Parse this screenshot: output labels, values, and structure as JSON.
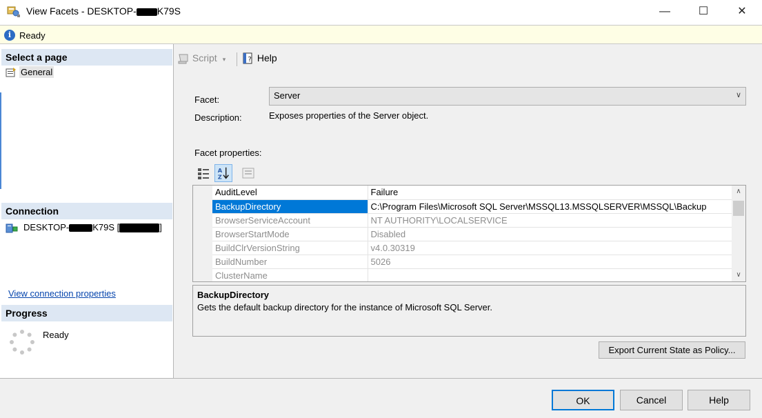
{
  "window": {
    "title_prefix": "View Facets - DESKTOP-",
    "title_suffix": "K79S",
    "minimize": "—",
    "maximize": "☐",
    "close": "✕"
  },
  "status": {
    "text": "Ready",
    "icon": "info-icon"
  },
  "left": {
    "select_page_header": "Select a page",
    "pages": [
      {
        "label": "General",
        "icon": "general-page-icon"
      }
    ],
    "connection_header": "Connection",
    "connection_prefix": "DESKTOP-",
    "connection_suffix": "K79S [",
    "connection_end": "]",
    "view_connection_link": "View connection properties",
    "progress_header": "Progress",
    "progress_text": "Ready"
  },
  "toolbar": {
    "script_label": "Script",
    "script_caret": "▾",
    "help_label": "Help"
  },
  "form": {
    "facet_label": "Facet:",
    "facet_value": "Server",
    "description_label": "Description:",
    "description_value": "Exposes properties of the Server object.",
    "facet_properties_label": "Facet properties:"
  },
  "properties": [
    {
      "name": "AuditLevel",
      "value": "Failure",
      "enabled": true,
      "selected": false
    },
    {
      "name": "BackupDirectory",
      "value": "C:\\Program Files\\Microsoft SQL Server\\MSSQL13.MSSQLSERVER\\MSSQL\\Backup",
      "enabled": true,
      "selected": true
    },
    {
      "name": "BrowserServiceAccount",
      "value": "NT AUTHORITY\\LOCALSERVICE",
      "enabled": false,
      "selected": false
    },
    {
      "name": "BrowserStartMode",
      "value": "Disabled",
      "enabled": false,
      "selected": false
    },
    {
      "name": "BuildClrVersionString",
      "value": "v4.0.30319",
      "enabled": false,
      "selected": false
    },
    {
      "name": "BuildNumber",
      "value": "5026",
      "enabled": false,
      "selected": false
    },
    {
      "name": "ClusterName",
      "value": "",
      "enabled": false,
      "selected": false
    }
  ],
  "property_desc": {
    "title": "BackupDirectory",
    "text": "Gets the default backup directory for the instance of Microsoft SQL Server."
  },
  "buttons": {
    "export": "Export Current State as Policy...",
    "ok": "OK",
    "cancel": "Cancel",
    "help": "Help"
  },
  "colors": {
    "accent": "#0078d7",
    "link": "#0645ad",
    "status_bg": "#fefee5",
    "section_header_bg": "#dde7f3"
  }
}
